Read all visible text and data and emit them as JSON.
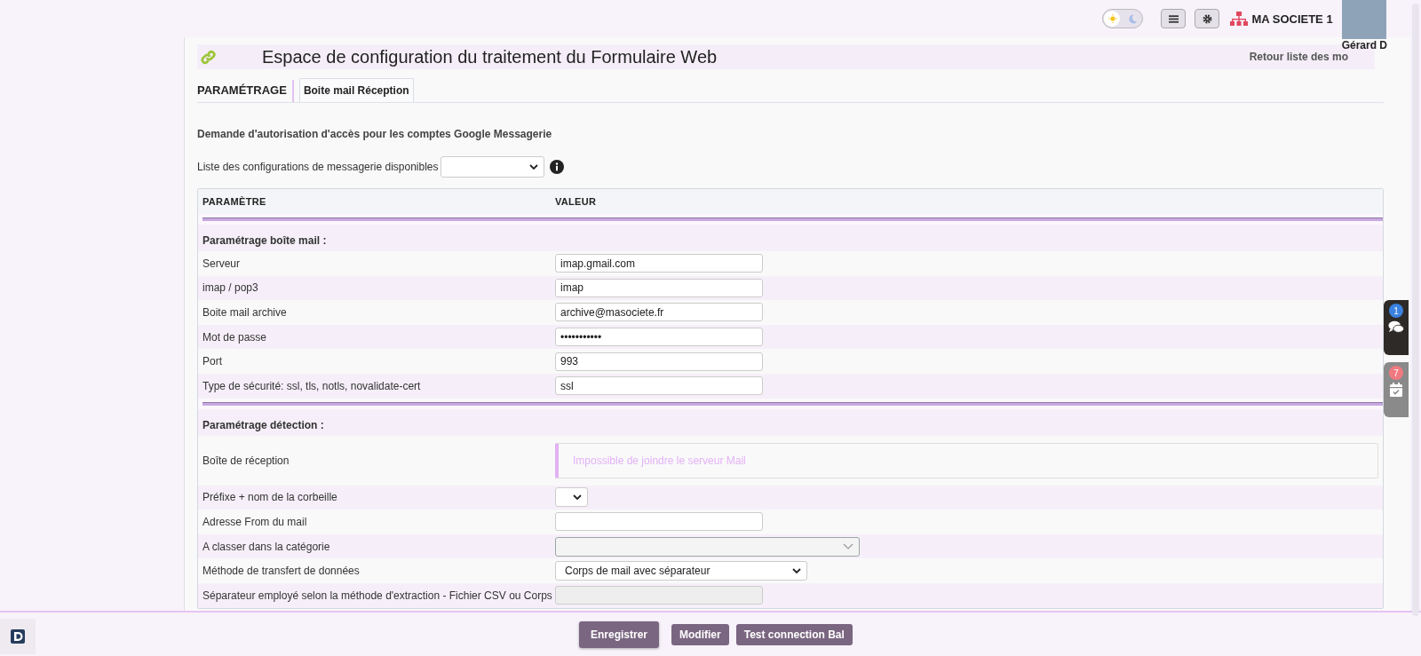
{
  "topbar": {
    "theme_toggle": {
      "dark": false
    },
    "company": "MA SOCIETE 1",
    "user": "Gérard D"
  },
  "header": {
    "title": "Espace de configuration du traitement du Formulaire Web",
    "back_link": "Retour liste des mo"
  },
  "tabs": [
    {
      "label": "PARAMÉTRAGE",
      "selected": false
    },
    {
      "label": "Boite mail Réception",
      "selected": true
    }
  ],
  "intro": "Demande d'autorisation d'accès pour les comptes Google Messagerie",
  "config_select": {
    "label": "Liste des configurations de messagerie disponibles"
  },
  "table": {
    "columns": [
      "PARAMÈTRE",
      "VALEUR"
    ],
    "rows": [
      {
        "kind": "divider"
      },
      {
        "kind": "section",
        "label": "Paramétrage boîte mail :"
      },
      {
        "kind": "input",
        "label": "Serveur",
        "value": "imap.gmail.com"
      },
      {
        "kind": "input",
        "label": "imap / pop3",
        "value": "imap"
      },
      {
        "kind": "input",
        "label": "Boite mail archive",
        "value": "archive@masociete.fr"
      },
      {
        "kind": "input",
        "label": "Mot de passe",
        "value": "•••••••••••"
      },
      {
        "kind": "input",
        "label": "Port",
        "value": "993"
      },
      {
        "kind": "input",
        "label": "Type de sécurité: ssl, tls, notls, novalidate-cert",
        "value": "ssl"
      },
      {
        "kind": "divider"
      },
      {
        "kind": "section",
        "label": "Paramétrage détection :"
      },
      {
        "kind": "message",
        "label": "Boîte de réception",
        "value": "Impossible de joindre le serveur Mail"
      },
      {
        "kind": "small-select",
        "label": "Préfixe + nom de la corbeille"
      },
      {
        "kind": "input",
        "label": "Adresse From du mail",
        "value": ""
      },
      {
        "kind": "combo",
        "label": "A classer dans la catégorie"
      },
      {
        "kind": "select",
        "label": "Méthode de transfert de données",
        "value": "Corps de mail avec séparateur"
      },
      {
        "kind": "readonly",
        "label": "Séparateur employé selon la méthode d'extraction - Fichier CSV ou Corps"
      }
    ]
  },
  "side_widgets": [
    {
      "kind": "chat",
      "count": "1",
      "color": "#3b82e0"
    },
    {
      "kind": "calendar",
      "count": "7",
      "color": "#f07a80"
    }
  ],
  "footer_buttons": [
    {
      "label": "Enregistrer",
      "primary": true
    },
    {
      "label": "Modifier",
      "primary": false
    },
    {
      "label": "Test connection Bal",
      "primary": false
    }
  ]
}
